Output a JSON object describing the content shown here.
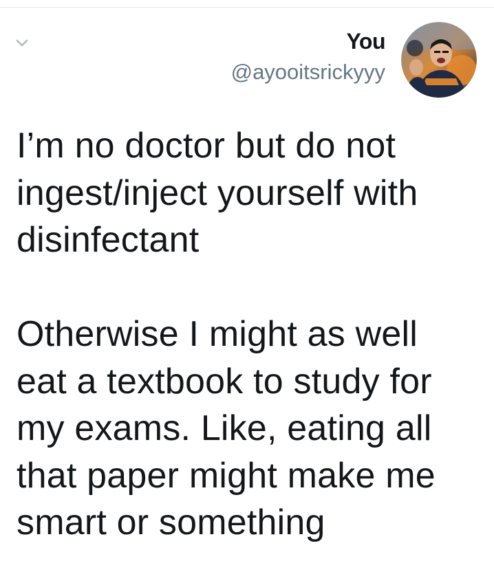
{
  "tweet": {
    "display_name": "You",
    "handle": "@ayooitsrickyyy",
    "text": "I’m no doctor but do not\ningest/inject yourself with\ndisinfectant\n\nOtherwise I might as well\neat a textbook to study for\nmy exams. Like, eating all\nthat paper might make me\nsmart or something"
  },
  "icons": {
    "menu": "chevron-down-icon"
  },
  "colors": {
    "text": "#14171a",
    "secondary": "#657786",
    "chevron": "#aab8c2",
    "divider": "#e1e8ed"
  }
}
